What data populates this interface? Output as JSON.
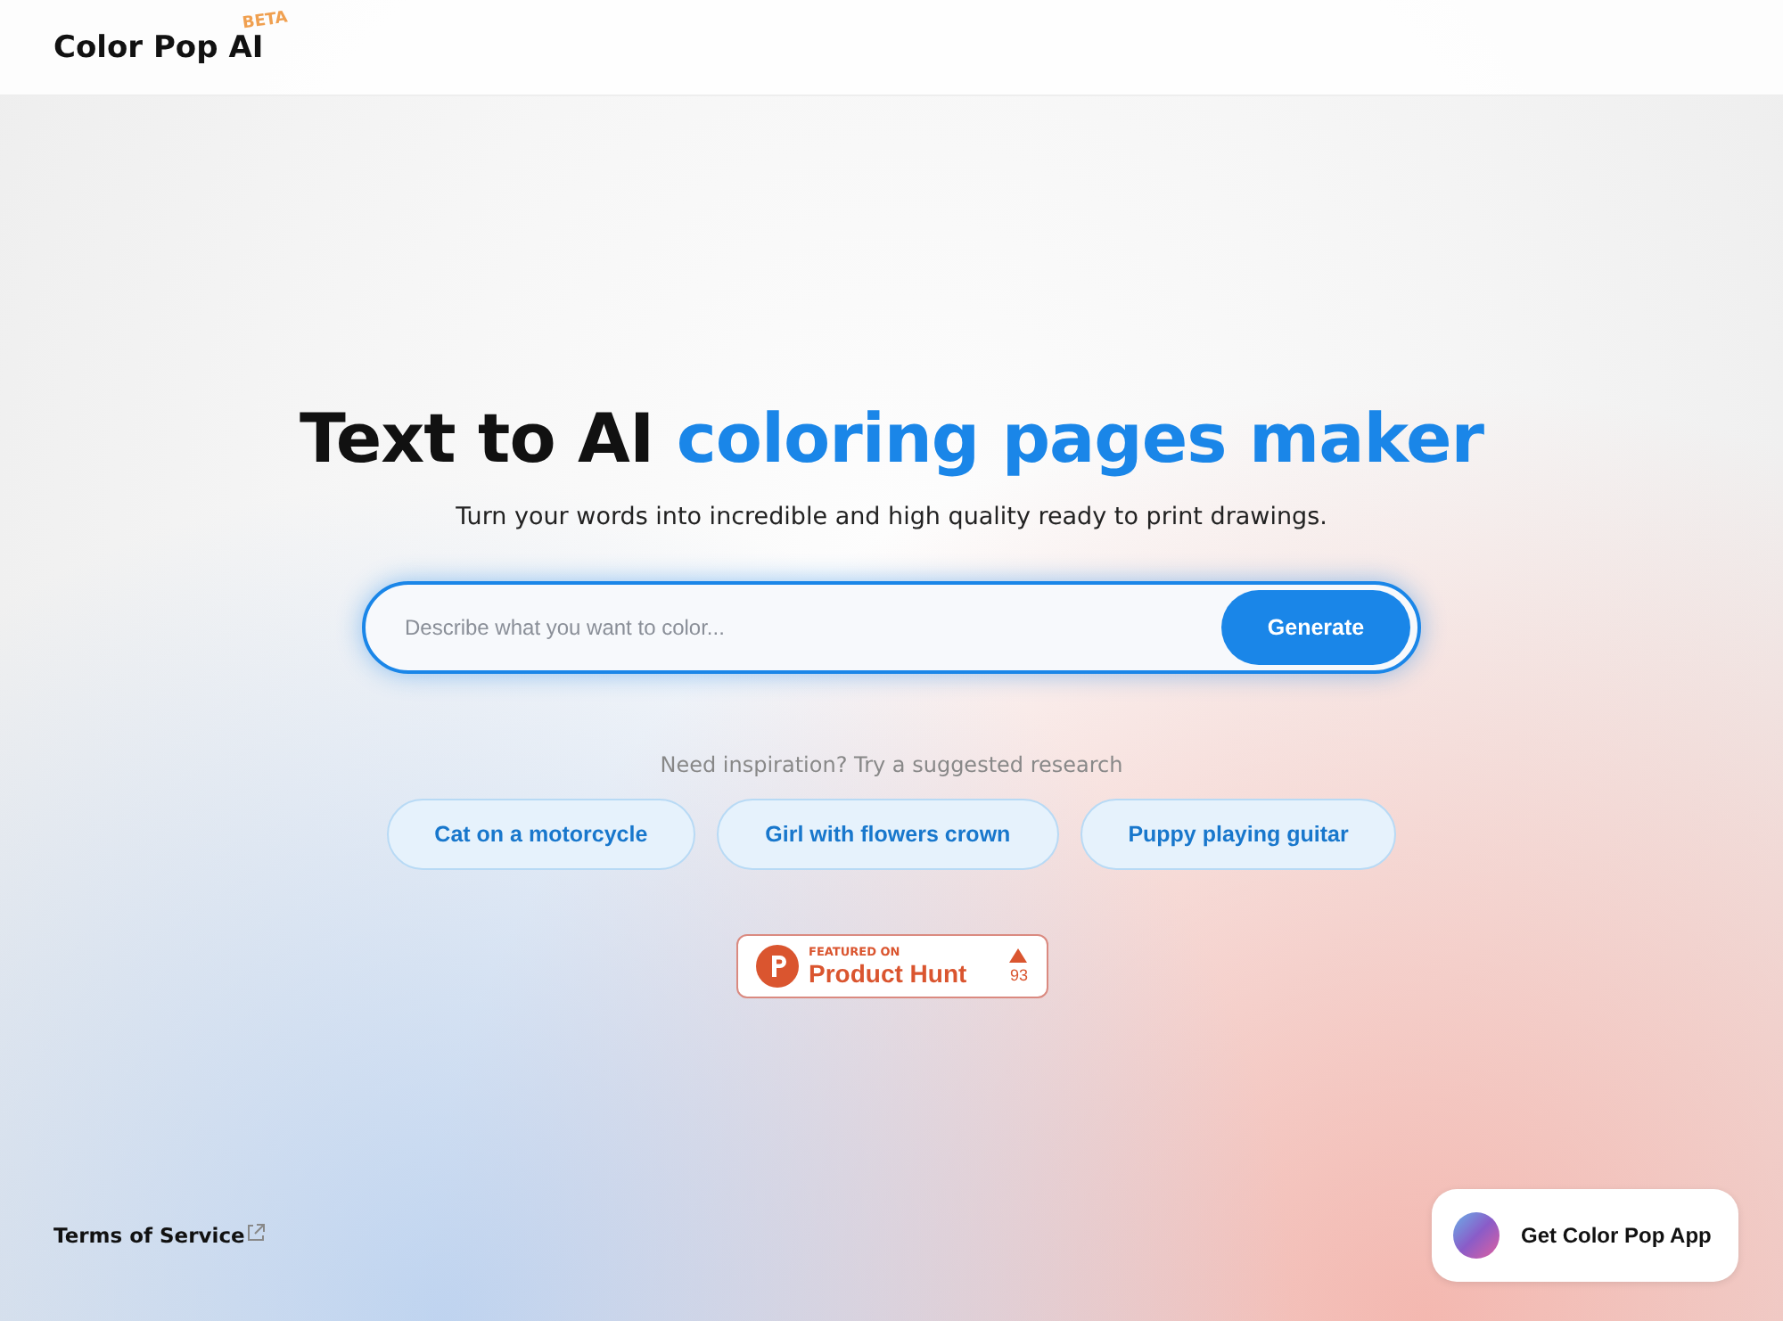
{
  "header": {
    "logo": "Color Pop AI",
    "badge": "BETA"
  },
  "hero": {
    "title_start": "Text to AI",
    "title_highlight": "coloring pages maker",
    "subtitle": "Turn your words into incredible and high quality ready to print drawings."
  },
  "search": {
    "placeholder": "Describe what you want to color...",
    "button": "Generate"
  },
  "suggestions": {
    "hint": "Need inspiration? Try a suggested research",
    "items": [
      "Cat on a motorcycle",
      "Girl with flowers crown",
      "Puppy playing guitar"
    ]
  },
  "product_hunt": {
    "caption": "FEATURED ON",
    "name": "Product Hunt",
    "votes": "93"
  },
  "footer": {
    "terms": "Terms of Service",
    "app_button": "Get Color Pop App"
  }
}
